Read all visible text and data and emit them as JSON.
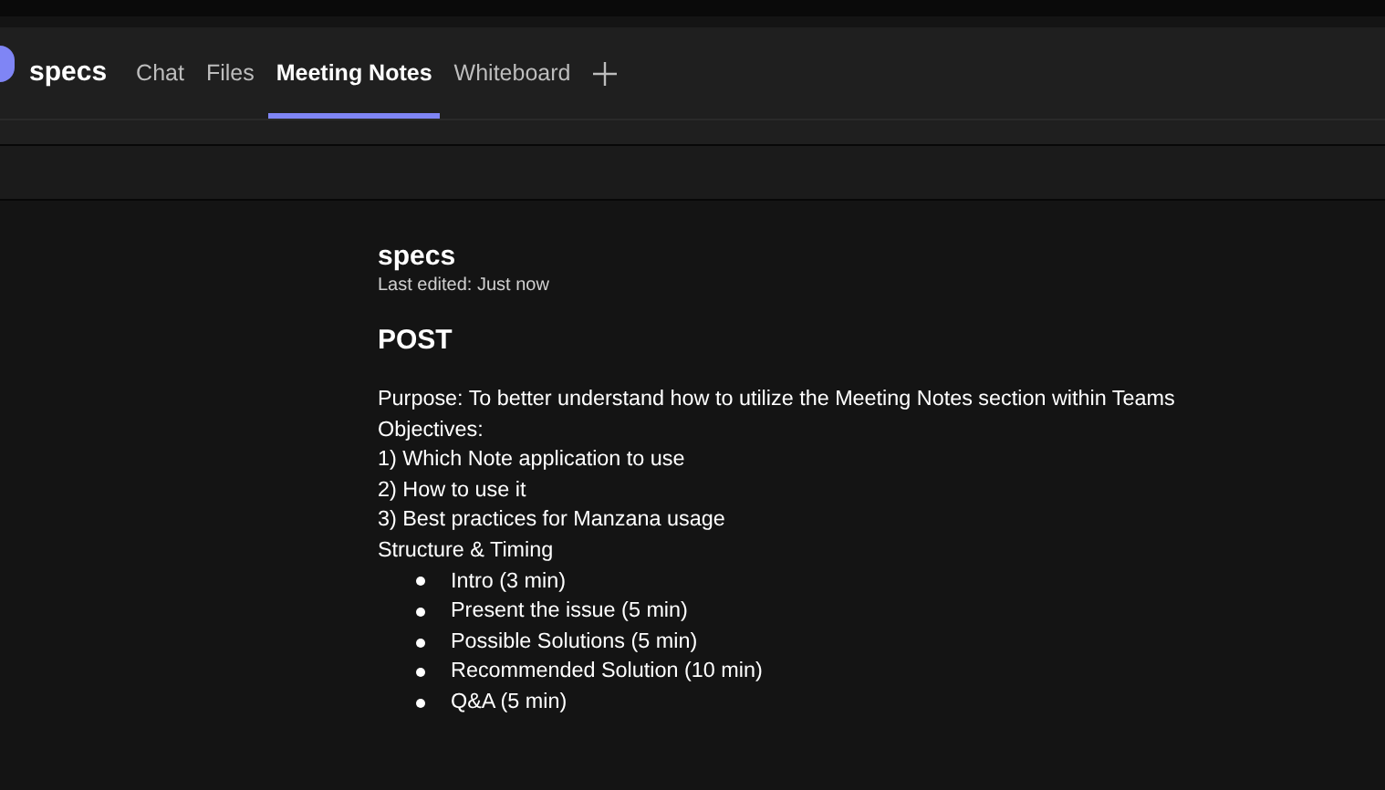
{
  "header": {
    "title": "specs",
    "tabs": [
      {
        "label": "Chat",
        "selected": false
      },
      {
        "label": "Files",
        "selected": false
      },
      {
        "label": "Meeting Notes",
        "selected": true
      },
      {
        "label": "Whiteboard",
        "selected": false
      }
    ]
  },
  "note": {
    "title": "specs",
    "last_edited": "Last edited: Just now",
    "heading": "POST",
    "lines": [
      "Purpose: To better understand how to utilize the Meeting Notes section within Teams",
      "Objectives:",
      "1) Which Note application to use",
      "2) How to use it",
      "3) Best practices for Manzana usage",
      "Structure & Timing"
    ],
    "bullets": [
      "Intro (3 min)",
      "Present the issue (5 min)",
      "Possible Solutions (5 min)",
      "Recommended Solution (10 min)",
      "Q&A (5 min)"
    ]
  }
}
